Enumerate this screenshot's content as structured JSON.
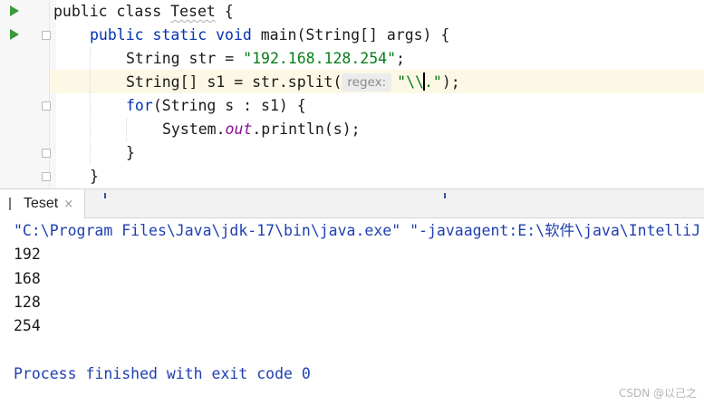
{
  "editor": {
    "lines": [
      {
        "parts": [
          {
            "t": "public class ",
            "c": "plain"
          },
          {
            "t": "Teset",
            "c": "squig"
          },
          {
            "t": " {",
            "c": "plain"
          }
        ]
      },
      {
        "parts": [
          {
            "t": "public static void ",
            "c": "kw"
          },
          {
            "t": "main(String[] args) {",
            "c": "plain"
          }
        ]
      },
      {
        "parts": [
          {
            "t": "String str = ",
            "c": "plain"
          },
          {
            "t": "\"192.168.128.254\"",
            "c": "str"
          },
          {
            "t": ";",
            "c": "plain"
          }
        ]
      },
      {
        "parts": [
          {
            "t": "String[] s1 = str.split(",
            "c": "plain"
          },
          {
            "t": "regex:",
            "c": "hint"
          },
          {
            "t": "\"\\\\",
            "c": "str"
          },
          {
            "t": "",
            "c": "caret"
          },
          {
            "t": ".\"",
            "c": "str"
          },
          {
            "t": ");",
            "c": "plain"
          }
        ]
      },
      {
        "parts": [
          {
            "t": "for",
            "c": "kw"
          },
          {
            "t": "(String s : s1) {",
            "c": "plain"
          }
        ]
      },
      {
        "parts": [
          {
            "t": "System.",
            "c": "plain"
          },
          {
            "t": "out",
            "c": "it"
          },
          {
            "t": ".println(s);",
            "c": "plain"
          }
        ]
      },
      {
        "parts": [
          {
            "t": "}",
            "c": "plain"
          }
        ]
      },
      {
        "parts": [
          {
            "t": "}",
            "c": "plain"
          }
        ]
      }
    ]
  },
  "run_tab": {
    "label": "Teset",
    "close": "×"
  },
  "console": {
    "command": "\"C:\\Program Files\\Java\\jdk-17\\bin\\java.exe\" \"-javaagent:E:\\软件\\java\\IntelliJ",
    "output": [
      "192",
      "168",
      "128",
      "254"
    ],
    "finished": "Process finished with exit code 0"
  },
  "watermark": "CSDN @以己之"
}
